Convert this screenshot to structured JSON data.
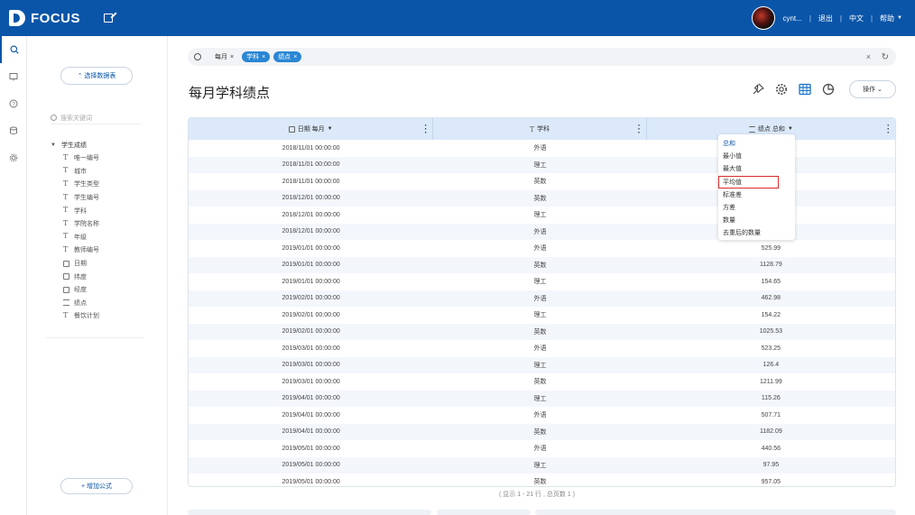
{
  "header": {
    "logo_text": "FOCUS",
    "username": "cynt...",
    "logout": "退出",
    "language": "中文",
    "help": "帮助"
  },
  "left_panel": {
    "select_table": "⌃ 选择数据表",
    "search_placeholder": "搜索关键词",
    "root": "学生成绩",
    "fields": [
      {
        "label": "唯一编号",
        "icon": "text-field-icon"
      },
      {
        "label": "城市",
        "icon": "text-field-icon"
      },
      {
        "label": "学生类型",
        "icon": "text-field-icon"
      },
      {
        "label": "学生编号",
        "icon": "text-field-icon"
      },
      {
        "label": "学科",
        "icon": "text-field-icon"
      },
      {
        "label": "学院名称",
        "icon": "text-field-icon"
      },
      {
        "label": "年级",
        "icon": "text-field-icon"
      },
      {
        "label": "教师编号",
        "icon": "text-field-icon"
      },
      {
        "label": "日期",
        "icon": "calendar-icon"
      },
      {
        "label": "纬度",
        "icon": "cube-icon"
      },
      {
        "label": "经度",
        "icon": "cube-icon"
      },
      {
        "label": "绩点",
        "icon": "number-icon"
      },
      {
        "label": "餐饮计划",
        "icon": "text-field-icon"
      }
    ],
    "add_formula": "+ 增加公式"
  },
  "search": {
    "tokens": [
      {
        "label": "每月",
        "style": "plain"
      },
      {
        "label": "学科",
        "style": "blue"
      },
      {
        "label": "绩点",
        "style": "blue"
      }
    ],
    "clear": "×",
    "refresh": "↻"
  },
  "page_title": "每月学科绩点",
  "ops_button": "操作 ⌄",
  "table": {
    "columns": [
      {
        "label": "日期 每月",
        "icon": "calendar-icon"
      },
      {
        "label": "学科",
        "icon": "text-field-icon"
      },
      {
        "label": "绩点 总和",
        "icon": "number-icon"
      }
    ],
    "rows": [
      [
        "2018/11/01 00:00:00",
        "外语",
        ""
      ],
      [
        "2018/11/01 00:00:00",
        "理工",
        ""
      ],
      [
        "2018/11/01 00:00:00",
        "英数",
        ""
      ],
      [
        "2018/12/01 00:00:00",
        "英数",
        ""
      ],
      [
        "2018/12/01 00:00:00",
        "理工",
        ""
      ],
      [
        "2018/12/01 00:00:00",
        "外语",
        ""
      ],
      [
        "2019/01/01 00:00:00",
        "外语",
        "525.99"
      ],
      [
        "2019/01/01 00:00:00",
        "英数",
        "1128.79"
      ],
      [
        "2019/01/01 00:00:00",
        "理工",
        "154.65"
      ],
      [
        "2019/02/01 00:00:00",
        "外语",
        "462.98"
      ],
      [
        "2019/02/01 00:00:00",
        "理工",
        "154.22"
      ],
      [
        "2019/02/01 00:00:00",
        "英数",
        "1025.53"
      ],
      [
        "2019/03/01 00:00:00",
        "外语",
        "523.25"
      ],
      [
        "2019/03/01 00:00:00",
        "理工",
        "126.4"
      ],
      [
        "2019/03/01 00:00:00",
        "英数",
        "1211.99"
      ],
      [
        "2019/04/01 00:00:00",
        "理工",
        "115.26"
      ],
      [
        "2019/04/01 00:00:00",
        "外语",
        "507.71"
      ],
      [
        "2019/04/01 00:00:00",
        "英数",
        "1182.09"
      ],
      [
        "2019/05/01 00:00:00",
        "外语",
        "440.56"
      ],
      [
        "2019/05/01 00:00:00",
        "理工",
        "97.95"
      ],
      [
        "2019/05/01 00:00:00",
        "英数",
        "957.05"
      ]
    ],
    "footer": "( 显示 1 - 21 行 , 总页数 1 )"
  },
  "aggregate_menu": {
    "items": [
      "总和",
      "最小值",
      "最大值",
      "平均值",
      "标准差",
      "方差",
      "数量",
      "去重后的数量"
    ],
    "active_index": 0,
    "highlight_index": 3
  },
  "colors": {
    "header_bg": "#0a55a8",
    "table_header_bg": "#dbe9fa",
    "token_blue": "#2a86d4",
    "highlight_red": "#d82c2c"
  }
}
